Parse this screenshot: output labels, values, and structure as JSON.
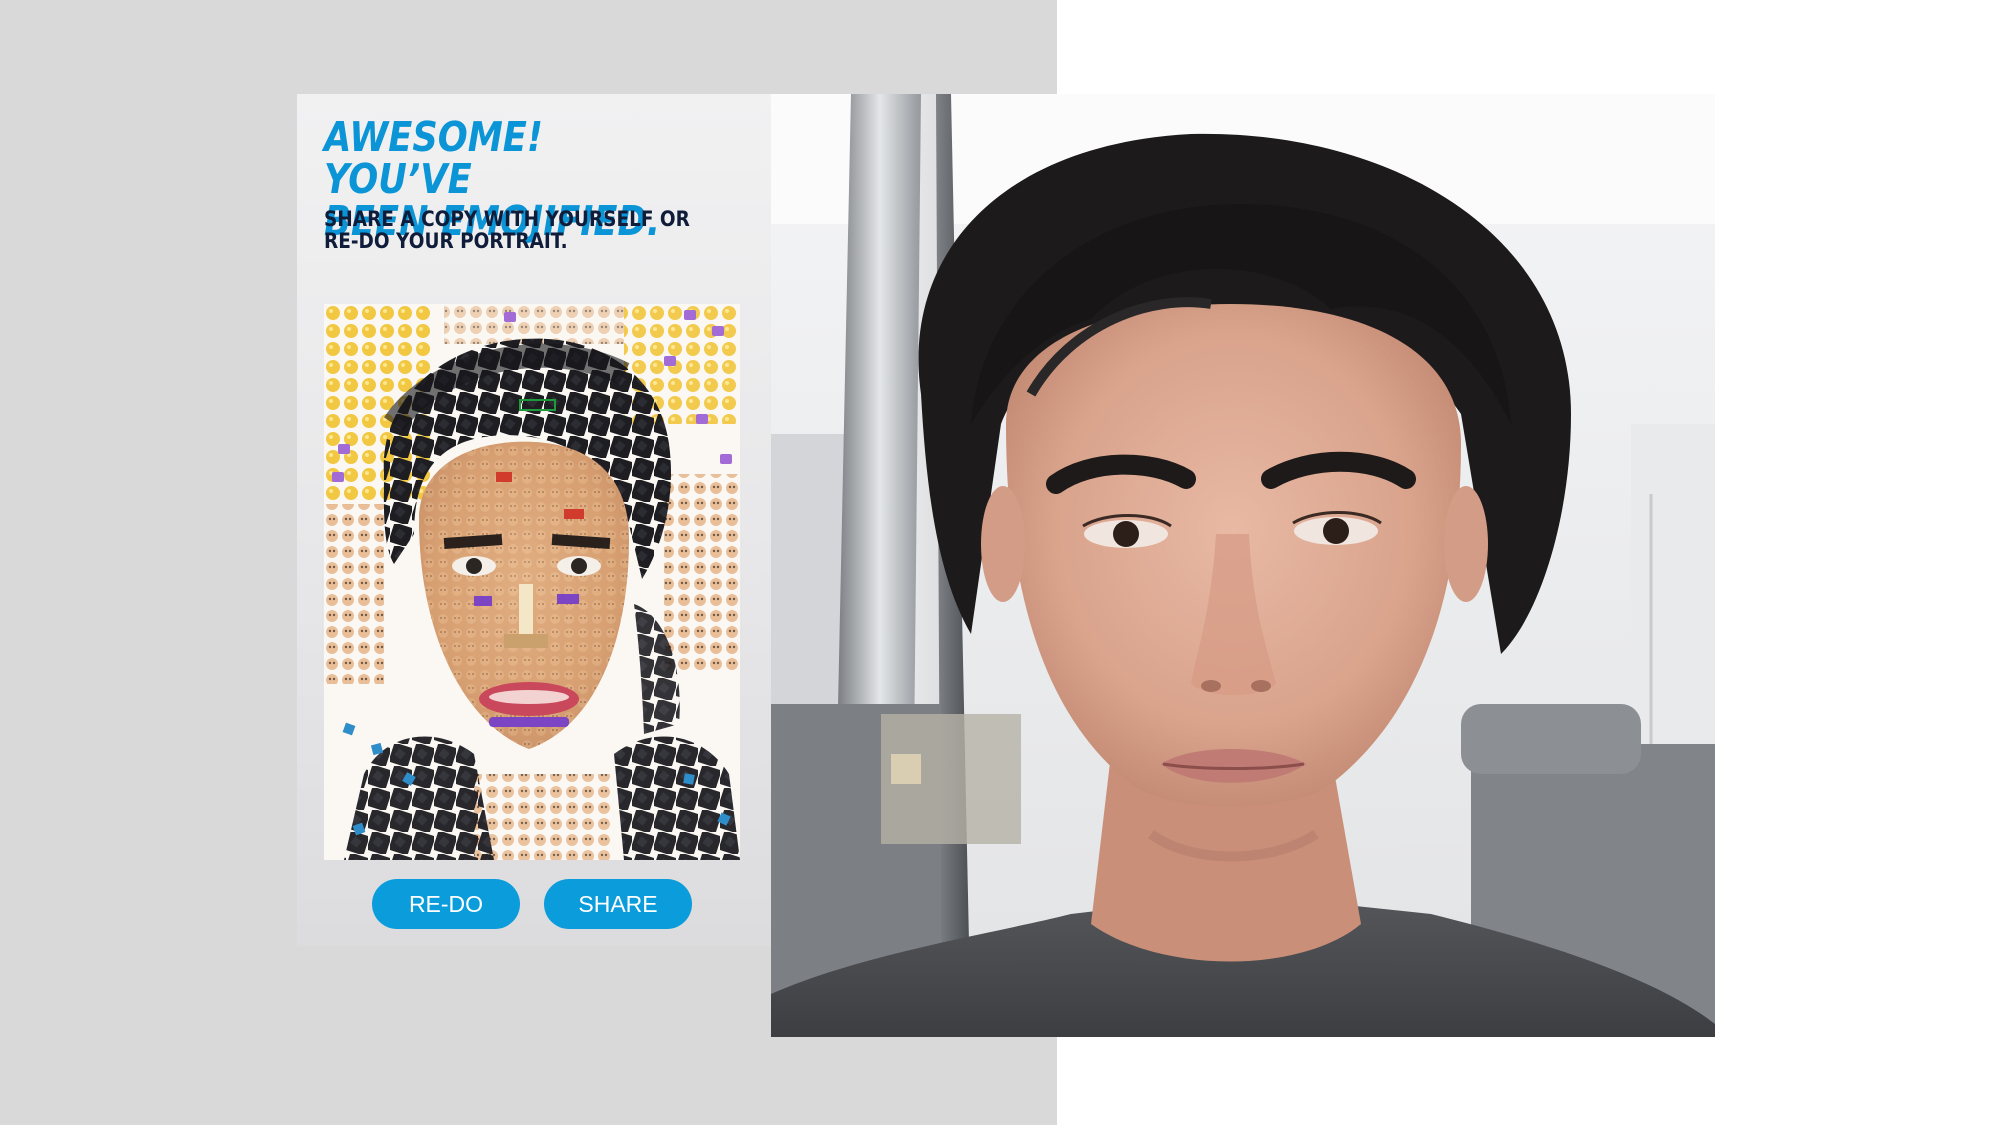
{
  "colors": {
    "accent_blue": "#0b95d6",
    "button_blue": "#0b9ddb",
    "navy_text": "#0f1d3a",
    "background_gray": "#d9d9da"
  },
  "result_screen": {
    "headline": "AWESOME! YOU’VE\nBEEN EMOJIFIED.",
    "subline": "SHARE A COPY WITH YOURSELF OR\nRE-DO YOUR PORTRAIT.",
    "redo_label": "RE-DO",
    "share_label": "SHARE"
  }
}
